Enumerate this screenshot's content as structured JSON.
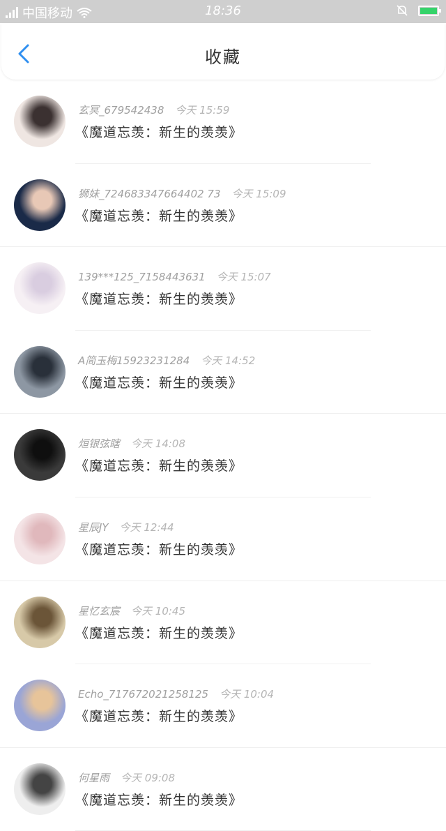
{
  "status_bar": {
    "carrier": "中国移动",
    "time": "18:36",
    "battery_color": "#35d36a"
  },
  "header": {
    "title": "收藏",
    "back_icon": "chevron-left-icon",
    "accent": "#2f8ff0"
  },
  "items": [
    {
      "name": "玄冥_679542438",
      "time": "今天 15:59",
      "message": "《魔道忘羡：新生的羡羡》",
      "avatar_colors": [
        "#efe6e2",
        "#3b3131"
      ]
    },
    {
      "name": "狮妹_724683347664402 73",
      "time": "今天 15:09",
      "message": "《魔道忘羡：新生的羡羡》",
      "avatar_colors": [
        "#1a2a48",
        "#e8c8b6"
      ]
    },
    {
      "name": "139***125_7158443631",
      "time": "今天 15:07",
      "message": "《魔道忘羡：新生的羡羡》",
      "avatar_colors": [
        "#f6f0f4",
        "#d9cde0"
      ]
    },
    {
      "name": "A简玉梅15923231284",
      "time": "今天 14:52",
      "message": "《魔道忘羡：新生的羡羡》",
      "avatar_colors": [
        "#8d97a3",
        "#29303a"
      ]
    },
    {
      "name": "烜银弦瞎",
      "time": "今天 14:08",
      "message": "《魔道忘羡：新生的羡羡》",
      "avatar_colors": [
        "#3a3a3a",
        "#0f0f0f"
      ]
    },
    {
      "name": "星辰JY",
      "time": "今天 12:44",
      "message": "《魔道忘羡：新生的羡羡》",
      "avatar_colors": [
        "#f4e4e6",
        "#e0b8bc"
      ]
    },
    {
      "name": "星忆玄宸",
      "time": "今天 10:45",
      "message": "《魔道忘羡：新生的羡羡》",
      "avatar_colors": [
        "#d7c9a8",
        "#6b5538"
      ]
    },
    {
      "name": "Echo_717672021258125",
      "time": "今天 10:04",
      "message": "《魔道忘羡：新生的羡羡》",
      "avatar_colors": [
        "#9aa5d6",
        "#e7c49a"
      ]
    },
    {
      "name": "何星雨",
      "time": "今天 09:08",
      "message": "《魔道忘羡：新生的羡羡》",
      "avatar_colors": [
        "#eeeeee",
        "#444444"
      ]
    }
  ]
}
